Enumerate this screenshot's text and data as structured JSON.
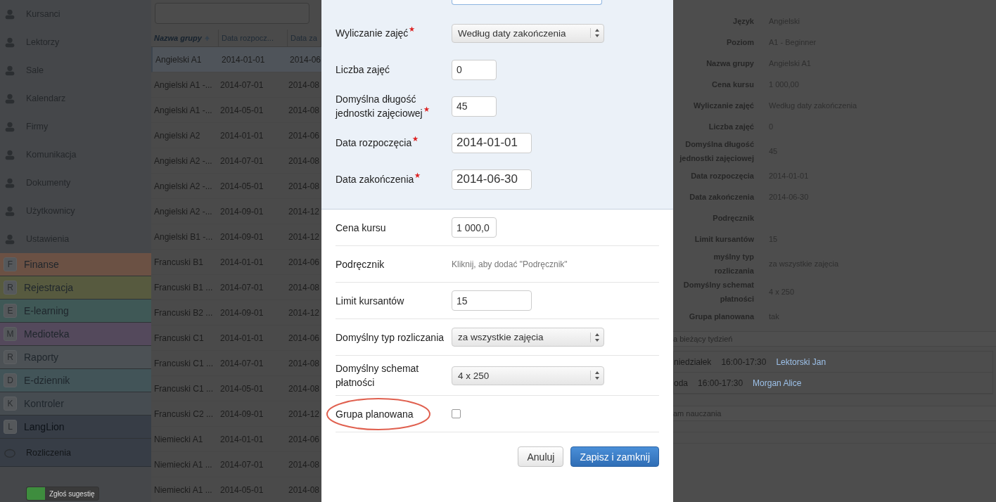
{
  "sidebar": {
    "items": [
      {
        "label": "Kursanci"
      },
      {
        "label": "Lektorzy"
      },
      {
        "label": "Sale"
      },
      {
        "label": "Kalendarz"
      },
      {
        "label": "Firmy"
      },
      {
        "label": "Komunikacja"
      },
      {
        "label": "Dokumenty"
      },
      {
        "label": "Użytkownicy"
      },
      {
        "label": "Ustawienia"
      }
    ],
    "modules": [
      {
        "letter": "F",
        "label": "Finanse",
        "color": "#6b5144"
      },
      {
        "letter": "R",
        "label": "Rejestracja",
        "color": "#575a3f"
      },
      {
        "letter": "E",
        "label": "E-learning",
        "color": "#3f5856"
      },
      {
        "letter": "M",
        "label": "Medioteka",
        "color": "#54495c"
      },
      {
        "letter": "R",
        "label": "Raporty",
        "color": "#4c5155"
      },
      {
        "letter": "D",
        "label": "E-dziennik",
        "color": "#425458"
      },
      {
        "letter": "K",
        "label": "Kontroler",
        "color": "#464c51"
      },
      {
        "letter": "L",
        "label": "LangLion",
        "color": "#373d46"
      }
    ],
    "sub_item": {
      "label": "Rozliczenia"
    },
    "suggest_button": "Zgłoś sugestię"
  },
  "table": {
    "columns": [
      {
        "label": "Nazwa grupy",
        "sorted": true
      },
      {
        "label": "Data rozpocz...",
        "sorted": false
      },
      {
        "label": "Data za",
        "sorted": false
      }
    ],
    "rows": [
      {
        "cells": [
          "Angielski A1",
          "2014-01-01",
          "2014-06"
        ],
        "selected": true
      },
      {
        "cells": [
          "Angielski A1 -...",
          "2014-07-01",
          "2014-08"
        ],
        "selected": false
      },
      {
        "cells": [
          "Angielski A1 -...",
          "2014-05-01",
          "2014-08"
        ],
        "selected": false
      },
      {
        "cells": [
          "Angielski A2",
          "2014-01-01",
          "2014-06"
        ],
        "selected": false
      },
      {
        "cells": [
          "Angielski A2 -...",
          "2014-07-01",
          "2014-08"
        ],
        "selected": false
      },
      {
        "cells": [
          "Angielski A2 -...",
          "2014-05-01",
          "2014-08"
        ],
        "selected": false
      },
      {
        "cells": [
          "Angielski A2 -...",
          "2014-09-01",
          "2014-12"
        ],
        "selected": false
      },
      {
        "cells": [
          "Angielski B1 -...",
          "2014-09-01",
          "2014-12"
        ],
        "selected": false
      },
      {
        "cells": [
          "Francuski B1",
          "2014-01-01",
          "2014-06"
        ],
        "selected": false
      },
      {
        "cells": [
          "Francuski B1 ...",
          "2014-07-01",
          "2014-08"
        ],
        "selected": false
      },
      {
        "cells": [
          "Francuski B2 ...",
          "2014-09-01",
          "2014-12"
        ],
        "selected": false
      },
      {
        "cells": [
          "Francuski C1",
          "2014-01-01",
          "2014-06"
        ],
        "selected": false
      },
      {
        "cells": [
          "Francuski C1 ...",
          "2014-07-01",
          "2014-08"
        ],
        "selected": false
      },
      {
        "cells": [
          "Francuski C1 ...",
          "2014-05-01",
          "2014-08"
        ],
        "selected": false
      },
      {
        "cells": [
          "Francuski C2 ...",
          "2014-09-01",
          "2014-12"
        ],
        "selected": false
      },
      {
        "cells": [
          "Niemiecki A1",
          "2014-01-01",
          "2014-06"
        ],
        "selected": false
      },
      {
        "cells": [
          "Niemiecki A1 ...",
          "2014-07-01",
          "2014-08"
        ],
        "selected": false
      },
      {
        "cells": [
          "Niemiecki A1 ...",
          "2014-05-01",
          "2014-08"
        ],
        "selected": false
      }
    ]
  },
  "dialog": {
    "top_fields": [
      {
        "kind": "select",
        "label": "Wyliczanie zajęć",
        "required": true,
        "value": "Według daty zakończenia"
      },
      {
        "kind": "input",
        "label": "Liczba zajęć",
        "required": false,
        "value": "0"
      },
      {
        "kind": "input",
        "label": "Domyślna długość jednostki zajęciowej",
        "required": true,
        "value": "45"
      },
      {
        "kind": "date",
        "label": "Data rozpoczęcia",
        "required": true,
        "value": "2014-01-01"
      },
      {
        "kind": "date",
        "label": "Data zakończenia",
        "required": true,
        "value": "2014-06-30"
      }
    ],
    "fields": [
      {
        "kind": "input",
        "label": "Cena kursu",
        "value": "1 000,0",
        "highlighted": false
      },
      {
        "kind": "link",
        "label": "Podręcznik",
        "value": "Kliknij, aby dodać \"Podręcznik\"",
        "highlighted": false
      },
      {
        "kind": "wide",
        "label": "Limit kursantów",
        "value": "15",
        "highlighted": false
      },
      {
        "kind": "select",
        "label": "Domyślny typ rozliczania",
        "value": "za wszystkie zajęcia",
        "highlighted": false
      },
      {
        "kind": "select",
        "label": "Domyślny schemat płatności",
        "value": "4 x 250",
        "highlighted": false
      },
      {
        "kind": "checkbox",
        "label": "Grupa planowana",
        "checked": false,
        "highlighted": true
      }
    ],
    "buttons": [
      {
        "label": "Anuluj",
        "primary": false
      },
      {
        "label": "Zapisz i zamknij",
        "primary": true
      }
    ]
  },
  "details": {
    "rows": [
      {
        "label": "Język",
        "value": "Angielski"
      },
      {
        "label": "Poziom",
        "value": "A1 - Beginner"
      },
      {
        "label": "Nazwa grupy",
        "value": "Angielski A1"
      },
      {
        "label": "Cena kursu",
        "value": "1 000,00"
      },
      {
        "label": "Wyliczanie zajęć",
        "value": "Według daty zakończenia"
      },
      {
        "label": "Liczba zajęć",
        "value": "0"
      },
      {
        "label": "Domyślna długość jednostki zajęciowej",
        "value": "45"
      },
      {
        "label": "Data rozpoczęcia",
        "value": "2014-01-01"
      },
      {
        "label": "Data zakończenia",
        "value": "2014-06-30"
      },
      {
        "label": "Podręcznik",
        "value": ""
      },
      {
        "label": "Limit kursantów",
        "value": "15"
      },
      {
        "label": "myślny typ rozliczania",
        "value": "za wszystkie zajęcia"
      },
      {
        "label": "Domyślny schemat płatności",
        "value": "4 x 250"
      },
      {
        "label": "Grupa planowana",
        "value": "tak"
      }
    ],
    "schedule_header": "a bieżący tydzień",
    "schedule": [
      {
        "day": "niedziałek",
        "time": "16:00-17:30",
        "teacher": "Lektorski Jan"
      },
      {
        "day": "oda",
        "time": "16:00-17:30",
        "teacher": "Morgan Alice"
      }
    ],
    "plan_header": "am nauczania"
  }
}
